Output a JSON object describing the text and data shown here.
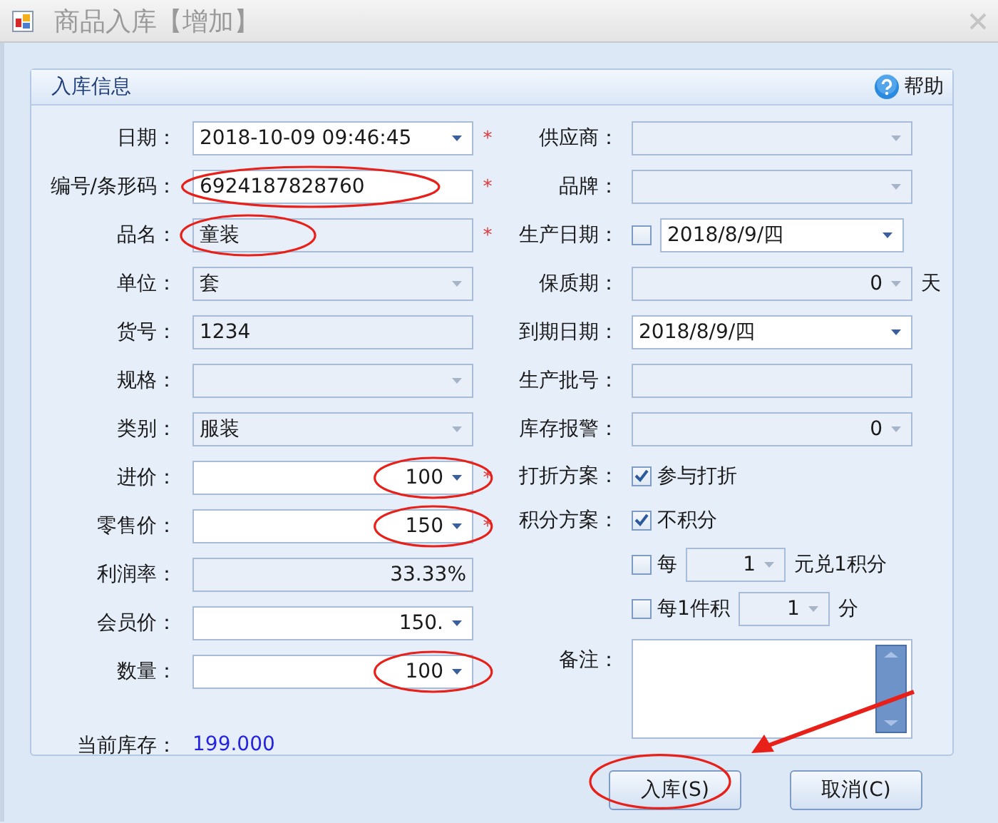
{
  "window": {
    "title": "商品入库【增加】"
  },
  "panel": {
    "title": "入库信息",
    "help": "帮助"
  },
  "required_mark": "*",
  "left_rows": [
    {
      "label": "日期：",
      "required": true,
      "controls": [
        {
          "kind": "dropdown",
          "value": "2018-10-09 09:46:45",
          "enabled": true
        }
      ]
    },
    {
      "label": "编号/条形码：",
      "required": true,
      "controls": [
        {
          "kind": "text",
          "value": "6924187828760",
          "enabled": true,
          "circled": true
        }
      ]
    },
    {
      "label": "品名：",
      "required": true,
      "controls": [
        {
          "kind": "text",
          "value": "童装",
          "enabled": false,
          "circled": true
        }
      ]
    },
    {
      "label": "单位：",
      "required": false,
      "controls": [
        {
          "kind": "dropdown",
          "value": "套",
          "enabled": false
        }
      ]
    },
    {
      "label": "货号：",
      "required": false,
      "controls": [
        {
          "kind": "text",
          "value": "1234",
          "enabled": false
        }
      ]
    },
    {
      "label": "规格：",
      "required": false,
      "controls": [
        {
          "kind": "dropdown",
          "enabled": false
        }
      ]
    },
    {
      "label": "类别：",
      "required": false,
      "controls": [
        {
          "kind": "dropdown",
          "value": "服装",
          "enabled": false
        }
      ]
    },
    {
      "label": "进价：",
      "required": true,
      "controls": [
        {
          "kind": "spin",
          "value": "100",
          "enabled": true,
          "circled": true
        }
      ]
    },
    {
      "label": "零售价：",
      "required": true,
      "controls": [
        {
          "kind": "spin",
          "value": "150",
          "enabled": true,
          "circled": true
        }
      ]
    },
    {
      "label": "利润率：",
      "required": false,
      "controls": [
        {
          "kind": "number",
          "value": "33.33%",
          "enabled": false
        }
      ]
    },
    {
      "label": "会员价：",
      "required": false,
      "controls": [
        {
          "kind": "spin",
          "value": "150.",
          "enabled": true
        }
      ]
    },
    {
      "label": "数量：",
      "required": false,
      "controls": [
        {
          "kind": "spin",
          "value": "100",
          "enabled": true,
          "circled": true
        }
      ]
    },
    {
      "label": "当前库存：",
      "required": false,
      "controls": [
        {
          "kind": "value",
          "value": "199.000"
        }
      ]
    }
  ],
  "right_rows": [
    {
      "label": "供应商：",
      "controls": [
        {
          "kind": "dropdown",
          "enabled": false
        }
      ]
    },
    {
      "label": "品牌：",
      "controls": [
        {
          "kind": "dropdown",
          "enabled": false
        }
      ]
    },
    {
      "label": "生产日期：",
      "controls": [
        {
          "kind": "checkbox",
          "checked": false
        },
        {
          "kind": "dropdown",
          "value": "2018/8/9/四",
          "enabled": true
        }
      ]
    },
    {
      "label": "保质期：",
      "controls": [
        {
          "kind": "spin",
          "value": "0",
          "enabled": false
        },
        {
          "kind": "note",
          "text": "天"
        }
      ]
    },
    {
      "label": "到期日期：",
      "controls": [
        {
          "kind": "dropdown",
          "value": "2018/8/9/四",
          "enabled": true
        }
      ]
    },
    {
      "label": "生产批号：",
      "controls": [
        {
          "kind": "text",
          "enabled": false
        }
      ]
    },
    {
      "label": "库存报警：",
      "controls": [
        {
          "kind": "spin",
          "value": "0",
          "enabled": false
        }
      ]
    },
    {
      "label": "打折方案：",
      "controls": [
        {
          "kind": "checkbox",
          "checked": true,
          "text": "参与打折"
        }
      ]
    },
    {
      "label": "积分方案：",
      "controls": [
        {
          "kind": "checkbox",
          "checked": true,
          "text": "不积分"
        }
      ]
    },
    {
      "controls": [
        {
          "kind": "checkbox",
          "checked": false,
          "text": "每"
        },
        {
          "kind": "mini-spin",
          "value": "1",
          "enabled": false
        },
        {
          "kind": "note",
          "text": "元兑1积分"
        }
      ]
    },
    {
      "controls": [
        {
          "kind": "checkbox",
          "checked": false,
          "text": "每1件积"
        },
        {
          "kind": "mini-spin",
          "value": "1",
          "enabled": false
        },
        {
          "kind": "note",
          "text": "分"
        }
      ]
    },
    {
      "label": "备注：",
      "controls": [
        {
          "kind": "memo"
        }
      ]
    }
  ],
  "buttons": [
    {
      "label": "入库(S)",
      "kind": "arrowed",
      "circled": true
    },
    {
      "label": "取消(C)",
      "kind": "plain",
      "circled": false
    }
  ]
}
